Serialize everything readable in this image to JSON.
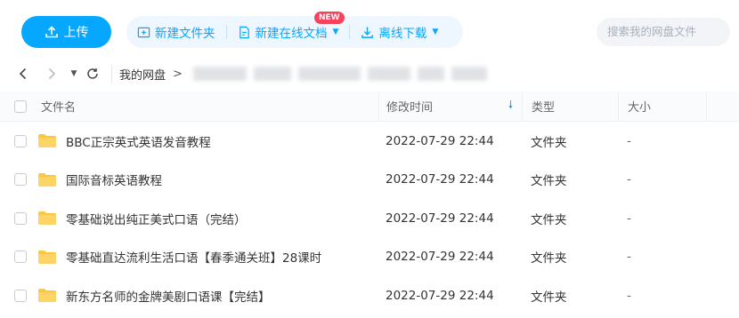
{
  "toolbar": {
    "upload_label": "上传",
    "new_folder_label": "新建文件夹",
    "new_online_doc_label": "新建在线文档",
    "new_badge": "NEW",
    "offline_download_label": "离线下载",
    "search_placeholder": "搜索我的网盘文件"
  },
  "nav": {
    "breadcrumb_home": "我的网盘",
    "breadcrumb_separator": ">"
  },
  "table": {
    "headers": {
      "name": "文件名",
      "modified": "修改时间",
      "type": "类型",
      "size": "大小"
    },
    "rows": [
      {
        "name": "BBC正宗英式英语发音教程",
        "modified": "2022-07-29 22:44",
        "type": "文件夹",
        "size": "-"
      },
      {
        "name": "国际音标英语教程",
        "modified": "2022-07-29 22:44",
        "type": "文件夹",
        "size": "-"
      },
      {
        "name": "零基础说出纯正美式口语（完结）",
        "modified": "2022-07-29 22:44",
        "type": "文件夹",
        "size": "-"
      },
      {
        "name": "零基础直达流利生活口语【春季通关班】28课时",
        "modified": "2022-07-29 22:44",
        "type": "文件夹",
        "size": "-"
      },
      {
        "name": "新东方名师的金牌美剧口语课【完结】",
        "modified": "2022-07-29 22:44",
        "type": "文件夹",
        "size": "-"
      }
    ]
  },
  "colors": {
    "accent": "#06a7ff",
    "badge": "#f5425d",
    "folder": "#ffc53d"
  }
}
